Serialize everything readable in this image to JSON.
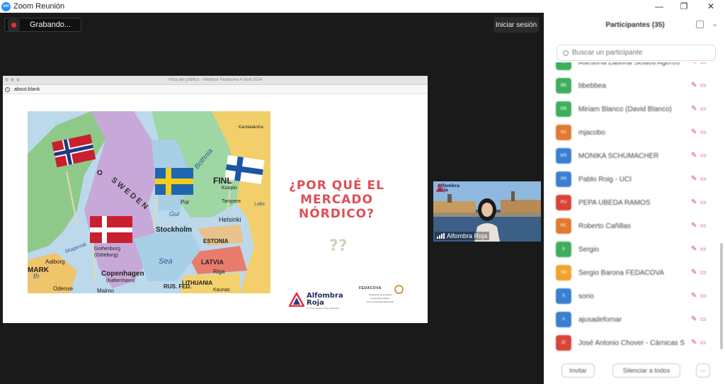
{
  "app": {
    "title": "Zoom Reunión",
    "logo_text": "zm"
  },
  "window_controls": {
    "minimize": "—",
    "restore": "❐",
    "close": "✕"
  },
  "meeting": {
    "recording_label": "Grabando...",
    "signin_label": "Iniciar sesión"
  },
  "shared_screen": {
    "window_title": "Vista del público - Webinar Fedacova 4 Abril 2024",
    "url": "about:blank",
    "slide": {
      "heading_line1": "¿POR QUÉ EL",
      "heading_line2": "MERCADO",
      "heading_line3": "NÓRDICO?",
      "question_marks": "??",
      "logo_brand": "Alfombra",
      "logo_brand2": "Roja",
      "logo_tagline": "Tu Internacional más allá Salto",
      "fed_name": "FEDACOVA",
      "fed_sub1": "Federación Empresarial",
      "fed_sub2": "de Agroalimentación",
      "fed_sub3": "de la Comunidad Valenciana",
      "map_labels": {
        "sweden": "S W E D E N",
        "finland": "FINL",
        "stockholm": "Stockholm",
        "helsinki": "Helsinki",
        "estonia": "ESTONIA",
        "latvia": "LATVIA",
        "riga": "Riga",
        "lithuania": "LITHUANIA",
        "copenhagen": "Copenhagen",
        "kobenhavn": "(København)",
        "gothenburg": "Gothenburg",
        "goteborg": "(Göteborg)",
        "aalborg": "Aalborg",
        "malmo": "Malmo",
        "odense": "Odense",
        "tampere": "Tampere",
        "kuopio": "Kuopio",
        "kandalaksha": "Kandalaksha",
        "rus_fed": "RUS. FED.",
        "mark": "MARK",
        "gulf": "Gul",
        "bothnia": "Bothnia",
        "sea": "Sea",
        "skagerrak": "Skagerrak",
        "th": "th",
        "por": "Por",
        "lake": "Lake",
        "kaunas": "Kaunas",
        "o_label": "O"
      }
    }
  },
  "video_tile": {
    "name": "Alfombra Roja",
    "logo_line1": "Alfombra",
    "logo_line2": "Roja"
  },
  "participants": {
    "title": "Participantes (35)",
    "search_placeholder": "Buscar un participante",
    "items": [
      {
        "name": "Asesoría Laboral Seiaos Ageros",
        "initials": "AL",
        "color": "#3fae5c"
      },
      {
        "name": "bbebbea",
        "initials": "BB",
        "color": "#3fae5c"
      },
      {
        "name": "Miriam Blanco (David Blanco)",
        "initials": "MB",
        "color": "#3fae5c"
      },
      {
        "name": "mjacobo",
        "initials": "MJ",
        "color": "#e07a2e"
      },
      {
        "name": "MONIKA SCHUMACHER",
        "initials": "MS",
        "color": "#3a7fd0"
      },
      {
        "name": "Pablo Roig - UCI",
        "initials": "PR",
        "color": "#3a7fd0"
      },
      {
        "name": "PEPA ÚBEDA RAMOS",
        "initials": "PU",
        "color": "#d94436"
      },
      {
        "name": "Roberto Cañillas",
        "initials": "RC",
        "color": "#e07a2e"
      },
      {
        "name": "Sergio",
        "initials": "S",
        "color": "#3fae5c"
      },
      {
        "name": "Sergio Barona FEDACOVA",
        "initials": "SB",
        "color": "#f0a32e"
      },
      {
        "name": "sorio",
        "initials": "S",
        "color": "#3a7fd0"
      },
      {
        "name": "ajusadefornar",
        "initials": "A",
        "color": "#3a7fd0"
      },
      {
        "name": "José Antonio Chover - Cárnicas Serrano",
        "initials": "JC",
        "color": "#d94436"
      }
    ],
    "footer": {
      "invite": "Invitar",
      "mute_all": "Silenciar a todos",
      "more": "···"
    }
  }
}
